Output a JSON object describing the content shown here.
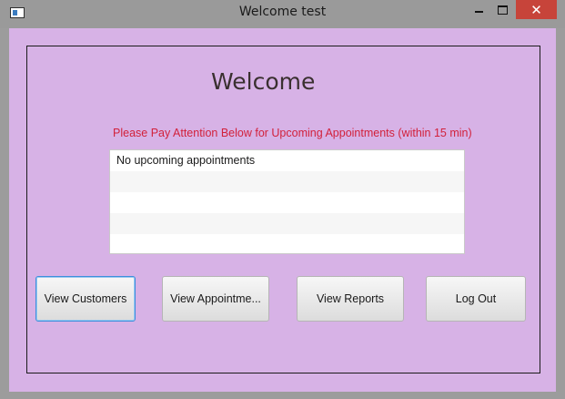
{
  "window": {
    "title": "Welcome test",
    "controls": {
      "minimize": "minimize-icon",
      "maximize": "maximize-icon",
      "close": "✕"
    }
  },
  "main": {
    "heading": "Welcome",
    "notice": "Please Pay Attention Below for Upcoming Appointments (within 15 min)",
    "appointments": [
      "No upcoming appointments",
      "",
      "",
      "",
      ""
    ],
    "notice_color": "#d2213b",
    "background_color": "#d7b2e6"
  },
  "buttons": {
    "view_customers": "View Customers",
    "view_appointments": "View Appointme...",
    "view_reports": "View Reports",
    "log_out": "Log Out"
  }
}
